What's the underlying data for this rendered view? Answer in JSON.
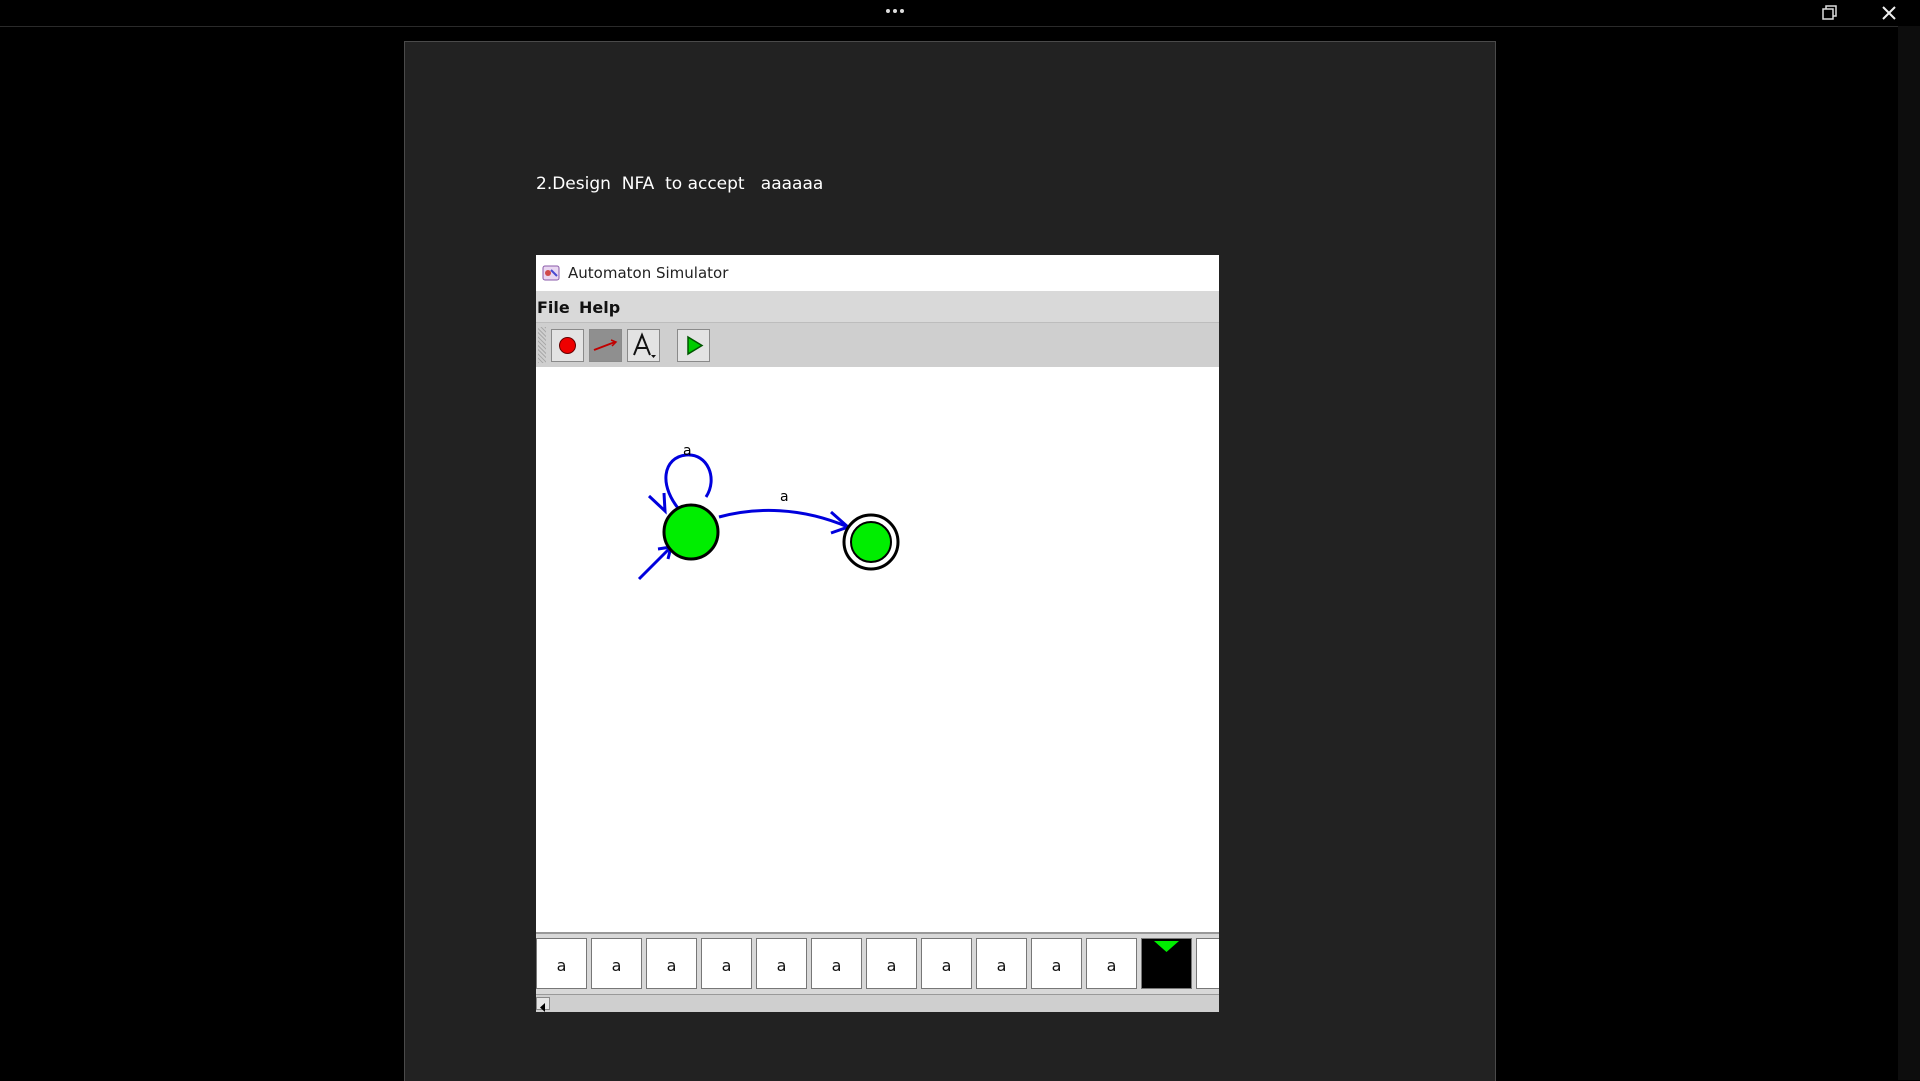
{
  "window": {
    "restore_tooltip": "",
    "close_tooltip": ""
  },
  "document": {
    "heading": "2.Design  NFA  to accept   aaaaaa"
  },
  "simulator": {
    "title": "Automaton Simulator",
    "menu": [
      "File",
      "Help"
    ],
    "tools": [
      "add-state-icon",
      "add-transition-icon",
      "label-icon",
      "run-icon"
    ],
    "diagram": {
      "loop_label": "a",
      "transition_label": "a",
      "state_color": "#00ee00",
      "arrow_color": "#0000dd"
    },
    "tape": [
      "a",
      "a",
      "a",
      "a",
      "a",
      "a",
      "a",
      "a",
      "a",
      "a",
      "a",
      "",
      ""
    ],
    "head_index": 11
  }
}
